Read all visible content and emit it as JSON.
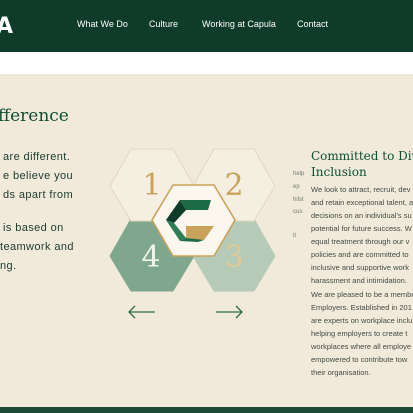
{
  "header": {
    "logo_fragment": "A",
    "nav": [
      "What We Do",
      "Culture",
      "Working at Capula",
      "Contact"
    ]
  },
  "section": {
    "heading_fragment": "fference",
    "left_lines": [
      "are different.",
      "e believe you",
      "ds apart from",
      "",
      "is based on",
      "teamwork and",
      "ng."
    ],
    "hex_numbers": [
      "1",
      "2",
      "4",
      "3"
    ],
    "hidden_text_fragments": [
      "help",
      "ep",
      "hilst",
      "cus",
      "it"
    ]
  },
  "inclusion": {
    "title_lines": [
      "Committed to Dive",
      "Inclusion"
    ],
    "paragraph1": [
      "We look to attract, recruit, dev",
      "and retain exceptional talent, a",
      "decisions on an individual's su",
      "potential for future success. W",
      "equal treatment through our v",
      "policies and are committed to",
      "inclusive and supportive work",
      "harassment and intimidation."
    ],
    "paragraph2": [
      "We are pleased to be a membe",
      "Employers. Established in 201",
      "are experts on workplace inclu",
      "helping employers to create t",
      "workplaces where all employe",
      "empowered to contribute tow",
      "their organisation."
    ]
  },
  "colors": {
    "nav_bg": "#0e3b2a",
    "panel_bg": "#f1eadb",
    "gold": "#c9a35b",
    "green_dark": "#7ea78d",
    "green_light": "#b5cbb7"
  }
}
